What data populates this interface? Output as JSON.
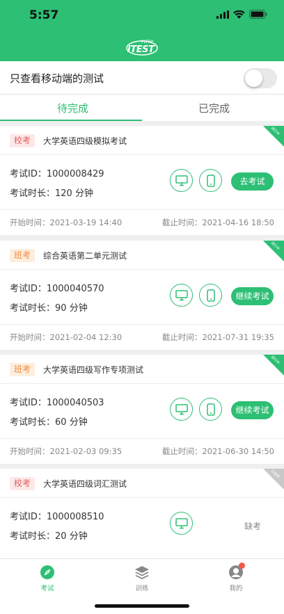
{
  "status": {
    "time": "5:57"
  },
  "logo": {
    "text": "ITEST",
    "small": "FLTRP"
  },
  "filter": {
    "label": "只查看移动端的测试",
    "toggle_on": false
  },
  "tabs": [
    {
      "label": "待完成",
      "active": true
    },
    {
      "label": "已完成",
      "active": false
    }
  ],
  "exams": [
    {
      "badge": "校考",
      "badge_color": "#e35b5b",
      "title": "大学英语四级模拟考试",
      "ribbon": "进行中",
      "id_label": "考试ID：",
      "id": "1000008429",
      "duration_label": "考试时长：",
      "duration": "120 分钟",
      "action": "去考试",
      "start_label": "开始时间：",
      "start": "2021-03-19 14:40",
      "end_label": "截止时间：",
      "end": "2021-04-16 18:50"
    },
    {
      "badge": "班考",
      "badge_color": "#f08a3e",
      "title": "综合英语第二单元测试",
      "ribbon": "进行中",
      "id_label": "考试ID：",
      "id": "1000040570",
      "duration_label": "考试时长：",
      "duration": "90 分钟",
      "action": "继续考试",
      "start_label": "开始时间：",
      "start": "2021-02-04 12:30",
      "end_label": "截止时间：",
      "end": "2021-07-31 19:35"
    },
    {
      "badge": "班考",
      "badge_color": "#f08a3e",
      "title": "大学英语四级写作专项测试",
      "ribbon": "进行中",
      "id_label": "考试ID：",
      "id": "1000040503",
      "duration_label": "考试时长：",
      "duration": "60 分钟",
      "action": "继续考试",
      "start_label": "开始时间：",
      "start": "2021-02-03 09:35",
      "end_label": "截止时间：",
      "end": "2021-06-30 14:50"
    },
    {
      "badge": "校考",
      "badge_color": "#e35b5b",
      "title": "大学英语四级词汇测试",
      "ribbon": "已结束",
      "id_label": "考试ID：",
      "id": "1000008510",
      "duration_label": "考试时长：",
      "duration": "20 分钟",
      "status": "缺考"
    }
  ],
  "tabbar": [
    {
      "label": "考试",
      "icon": "compass-icon",
      "active": true
    },
    {
      "label": "训练",
      "icon": "layers-icon",
      "active": false
    },
    {
      "label": "我的",
      "icon": "profile-icon",
      "active": false,
      "notification_dot": true
    }
  ],
  "colors": {
    "primary": "#2dbf74",
    "school_badge": "#e35b5b",
    "class_badge": "#f08a3e"
  }
}
